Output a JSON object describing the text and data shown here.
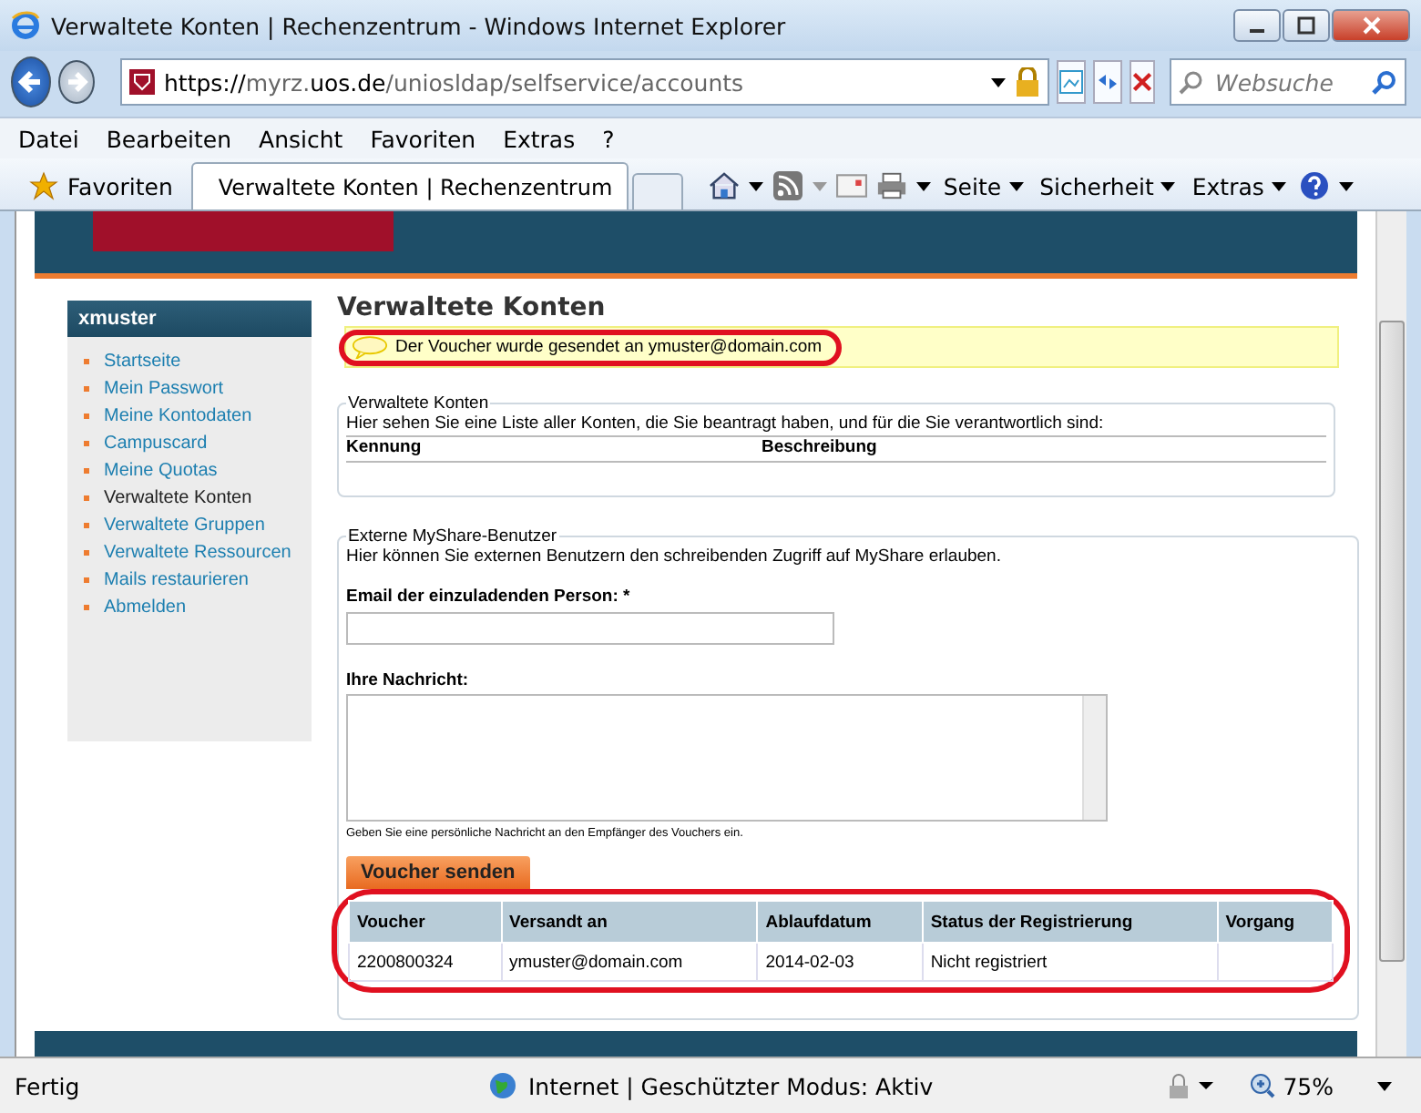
{
  "window": {
    "title": "Verwaltete Konten | Rechenzentrum - Windows Internet Explorer"
  },
  "address_bar": {
    "url_prefix": "https://",
    "url_host_pre": "myrz.",
    "url_host": "uos.de",
    "url_path": "/uniosldap/selfservice/accounts",
    "search_placeholder": "Websuche"
  },
  "menu": [
    "Datei",
    "Bearbeiten",
    "Ansicht",
    "Favoriten",
    "Extras",
    "?"
  ],
  "favorites_bar": {
    "favorites": "Favoriten",
    "tabs": [
      {
        "label": "Verwaltete Konten | Rechenzentrum",
        "selected": true
      }
    ],
    "tools": [
      "Seite",
      "Sicherheit",
      "Extras"
    ]
  },
  "sidebar": {
    "user": "xmuster",
    "items": [
      {
        "label": "Startseite",
        "selected": false
      },
      {
        "label": "Mein Passwort",
        "selected": false
      },
      {
        "label": "Meine Kontodaten",
        "selected": false
      },
      {
        "label": "Campuscard",
        "selected": false
      },
      {
        "label": "Meine Quotas",
        "selected": false
      },
      {
        "label": "Verwaltete Konten",
        "selected": true
      },
      {
        "label": "Verwaltete Gruppen",
        "selected": false
      },
      {
        "label": "Verwaltete Ressourcen",
        "selected": false
      },
      {
        "label": "Mails restaurieren",
        "selected": false
      },
      {
        "label": "Abmelden",
        "selected": false
      }
    ]
  },
  "page": {
    "title": "Verwaltete Konten",
    "notice": "Der Voucher wurde gesendet an ymuster@domain.com",
    "accounts": {
      "legend": "Verwaltete Konten",
      "description": "Hier sehen Sie eine Liste aller Konten, die Sie beantragt haben, und für die Sie verantwortlich sind:",
      "columns": [
        "Kennung",
        "Beschreibung"
      ]
    },
    "external": {
      "legend": "Externe MyShare-Benutzer",
      "description": "Hier können Sie externen Benutzern den schreibenden Zugriff auf MyShare erlauben.",
      "email_label": "Email der einzuladenden Person: *",
      "message_label": "Ihre Nachricht:",
      "hint": "Geben Sie eine persönliche Nachricht an den Empfänger des Vouchers ein.",
      "button": "Voucher senden",
      "table": {
        "columns": [
          "Voucher",
          "Versandt an",
          "Ablaufdatum",
          "Status der Registrierung",
          "Vorgang"
        ],
        "rows": [
          [
            "2200800324",
            "ymuster@domain.com",
            "2014-02-03",
            "Nicht registriert",
            ""
          ]
        ]
      }
    }
  },
  "status_bar": {
    "status": "Fertig",
    "zone": "Internet | Geschützter Modus: Aktiv",
    "zoom": "75%"
  }
}
